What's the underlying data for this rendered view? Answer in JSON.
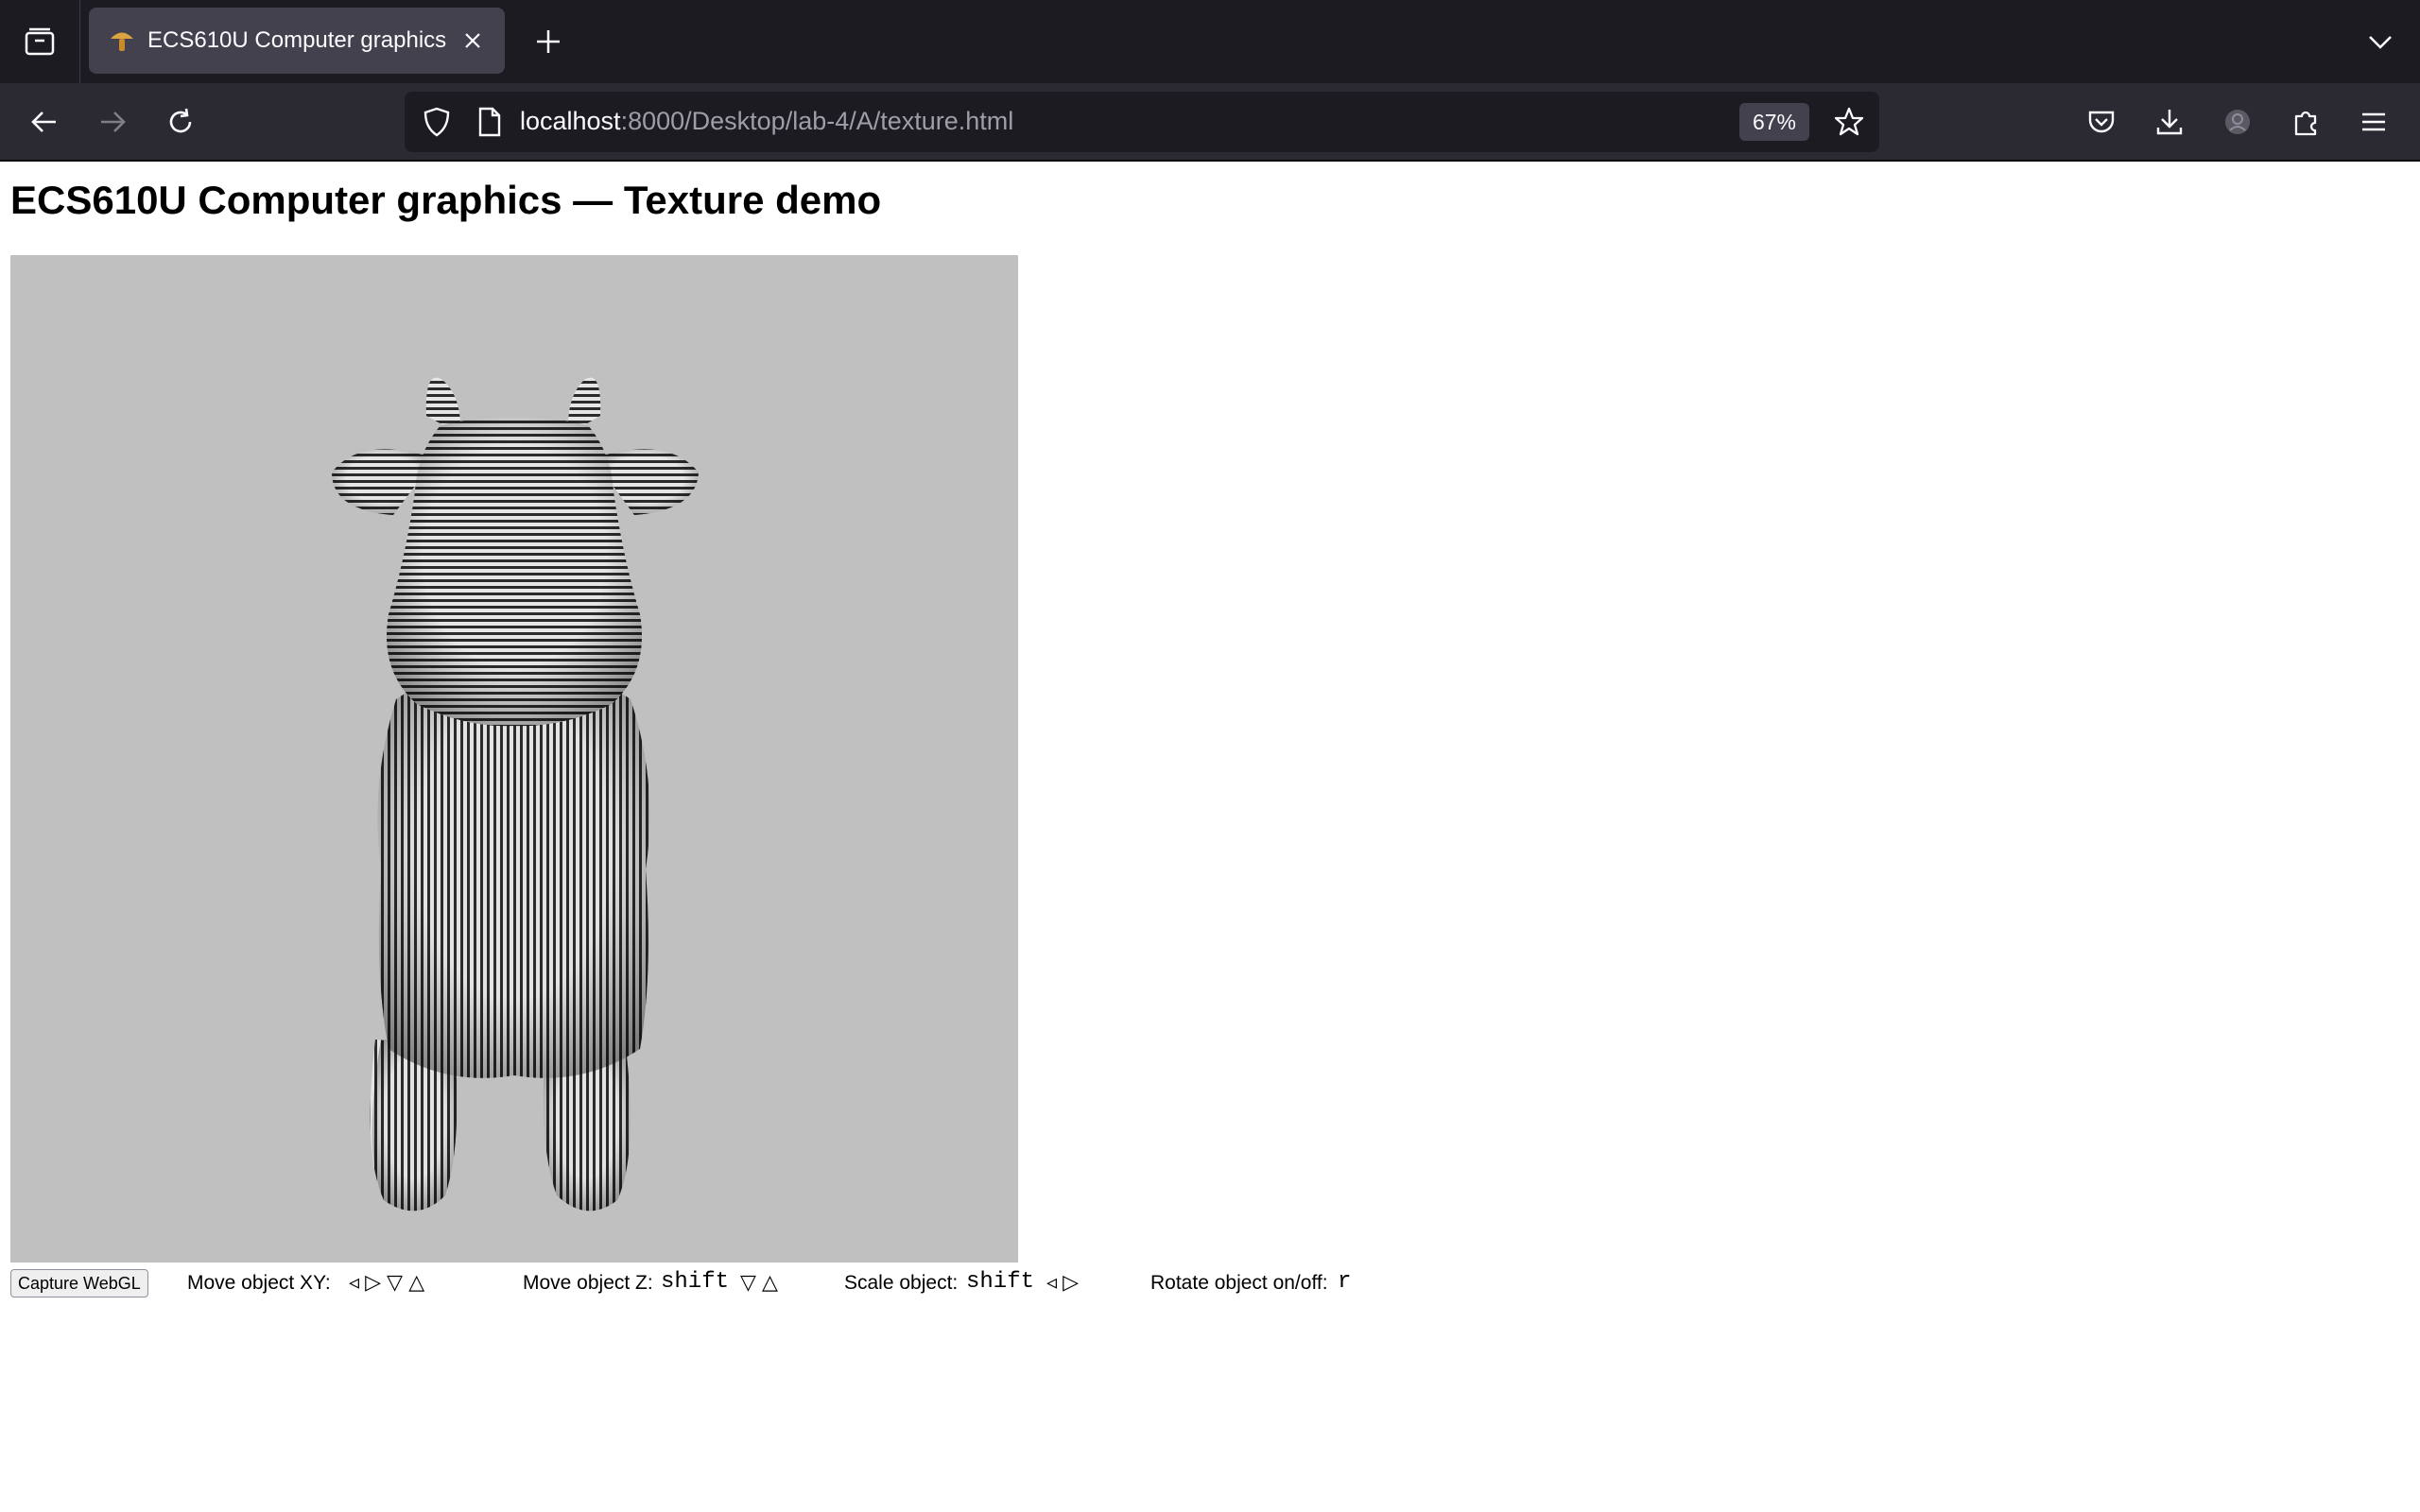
{
  "browser": {
    "tab_title": "ECS610U Computer graphics",
    "url_host": "localhost",
    "url_rest": ":8000/Desktop/lab-4/A/texture.html",
    "zoom": "67%"
  },
  "page": {
    "title": "ECS610U Computer graphics — Texture demo"
  },
  "controls": {
    "capture_label": "Capture WebGL",
    "move_xy_label": "Move object XY:",
    "move_xy_keys": "◃ ▷ ▽ △",
    "move_z_label": "Move object Z:",
    "move_z_mod": "shift",
    "move_z_keys": "▽ △",
    "scale_label": "Scale object:",
    "scale_mod": "shift",
    "scale_keys": "◃ ▷",
    "rotate_label": "Rotate object on/off:",
    "rotate_key": "r"
  },
  "colors": {
    "canvas_bg": "#c0c0c0",
    "chrome_dark": "#1c1b22",
    "navbar": "#2b2a33"
  }
}
